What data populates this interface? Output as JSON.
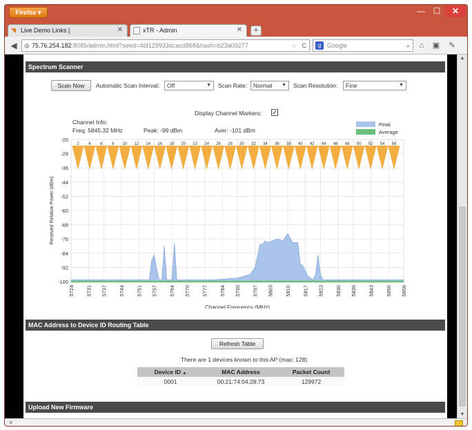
{
  "browser": {
    "menu_label": "Firefox ▾",
    "window_controls": {
      "minimize": "—",
      "maximize": "☐",
      "close": "✕"
    },
    "tabs": [
      {
        "label": "Live Demo Links |",
        "icon": "rss-icon",
        "close": "✕"
      },
      {
        "label": "xTR - Admin",
        "icon": "page-icon",
        "close": "✕"
      }
    ],
    "newtab": "+",
    "url_host": "75.76.254.182",
    "url_rest": ":8085/admin.html?seed=46f129933dcacd868&hash=b23a09277",
    "search_placeholder": "Google",
    "search_engine_glyph": "g"
  },
  "sections": {
    "spectrum": "Spectrum Scanner",
    "mac": "MAC Address to Device ID Routing Table",
    "firmware": "Upload New Firmware"
  },
  "scanner": {
    "scan_now": "Scan Now",
    "interval_label": "Automatic Scan Interval:",
    "interval_value": "Off",
    "rate_label": "Scan Rate:",
    "rate_value": "Normal",
    "resolution_label": "Scan Resolution:",
    "resolution_value": "Fine",
    "markers_label": "Display Channel Markers:",
    "markers_checked": "✓"
  },
  "channel_info": {
    "title": "Channel Info:",
    "freq": "Freq: 5845.32 MHz",
    "peak": "Peak: -99 dBm",
    "aver": "Aver: -101 dBm"
  },
  "chart_data": {
    "type": "area",
    "xlabel": "Channel Frequency (MHz)",
    "ylabel": "Received Relative Power (dBm)",
    "ylim": [
      -100,
      -20
    ],
    "yticks": [
      -20,
      -28,
      -36,
      -44,
      -52,
      -60,
      -68,
      -76,
      -84,
      -92,
      -100
    ],
    "xlim": [
      5724,
      5856
    ],
    "xticks": [
      5724,
      5731,
      5737,
      5744,
      5751,
      5757,
      5764,
      5770,
      5777,
      5784,
      5790,
      5797,
      5803,
      5810,
      5817,
      5823,
      5830,
      5836,
      5843,
      5850,
      5856
    ],
    "grid": true,
    "legend_position": "top-right",
    "series": [
      {
        "name": "Peak",
        "color": "#a9c4ea",
        "x": [
          5724,
          5730,
          5740,
          5750,
          5755,
          5756,
          5757,
          5758,
          5759,
          5760,
          5761,
          5762,
          5763,
          5764,
          5765,
          5766,
          5767,
          5768,
          5769,
          5770,
          5780,
          5790,
          5795,
          5797,
          5799,
          5800,
          5801,
          5802,
          5804,
          5806,
          5808,
          5810,
          5812,
          5814,
          5815,
          5816,
          5817,
          5818,
          5820,
          5821,
          5822,
          5823,
          5824,
          5830,
          5840,
          5850,
          5856
        ],
        "values": [
          -99,
          -99,
          -99,
          -99,
          -99,
          -88,
          -85,
          -93,
          -99,
          -99,
          -80,
          -99,
          -99,
          -99,
          -78,
          -99,
          -99,
          -99,
          -99,
          -99,
          -99,
          -98,
          -96,
          -92,
          -79,
          -79,
          -77,
          -78,
          -77,
          -76,
          -77,
          -73,
          -78,
          -78,
          -90,
          -91,
          -94,
          -97,
          -99,
          -96,
          -85,
          -96,
          -99,
          -99,
          -99,
          -99,
          -99
        ]
      },
      {
        "name": "Average",
        "color": "#6abf7b",
        "x": [
          5724,
          5856
        ],
        "values": [
          -100,
          -100
        ]
      }
    ],
    "channel_markers": [
      2,
      4,
      6,
      8,
      10,
      12,
      14,
      16,
      18,
      20,
      22,
      24,
      26,
      28,
      30,
      32,
      34,
      36,
      38,
      40,
      42,
      44,
      46,
      48,
      50,
      52,
      54,
      56
    ]
  },
  "mac_table": {
    "refresh": "Refresh Table",
    "note": "There are 1 devices known to this AP (max: 128)",
    "headers": [
      "Device ID",
      "MAC Address",
      "Packet Count"
    ],
    "rows": [
      [
        "0001",
        "00:21:74:04:28:73",
        "129972"
      ]
    ]
  },
  "colors": {
    "section_bar": "#4a4a4a",
    "peak": "#a9c4ea",
    "average": "#6abf7b",
    "marker": "#f0a020"
  }
}
